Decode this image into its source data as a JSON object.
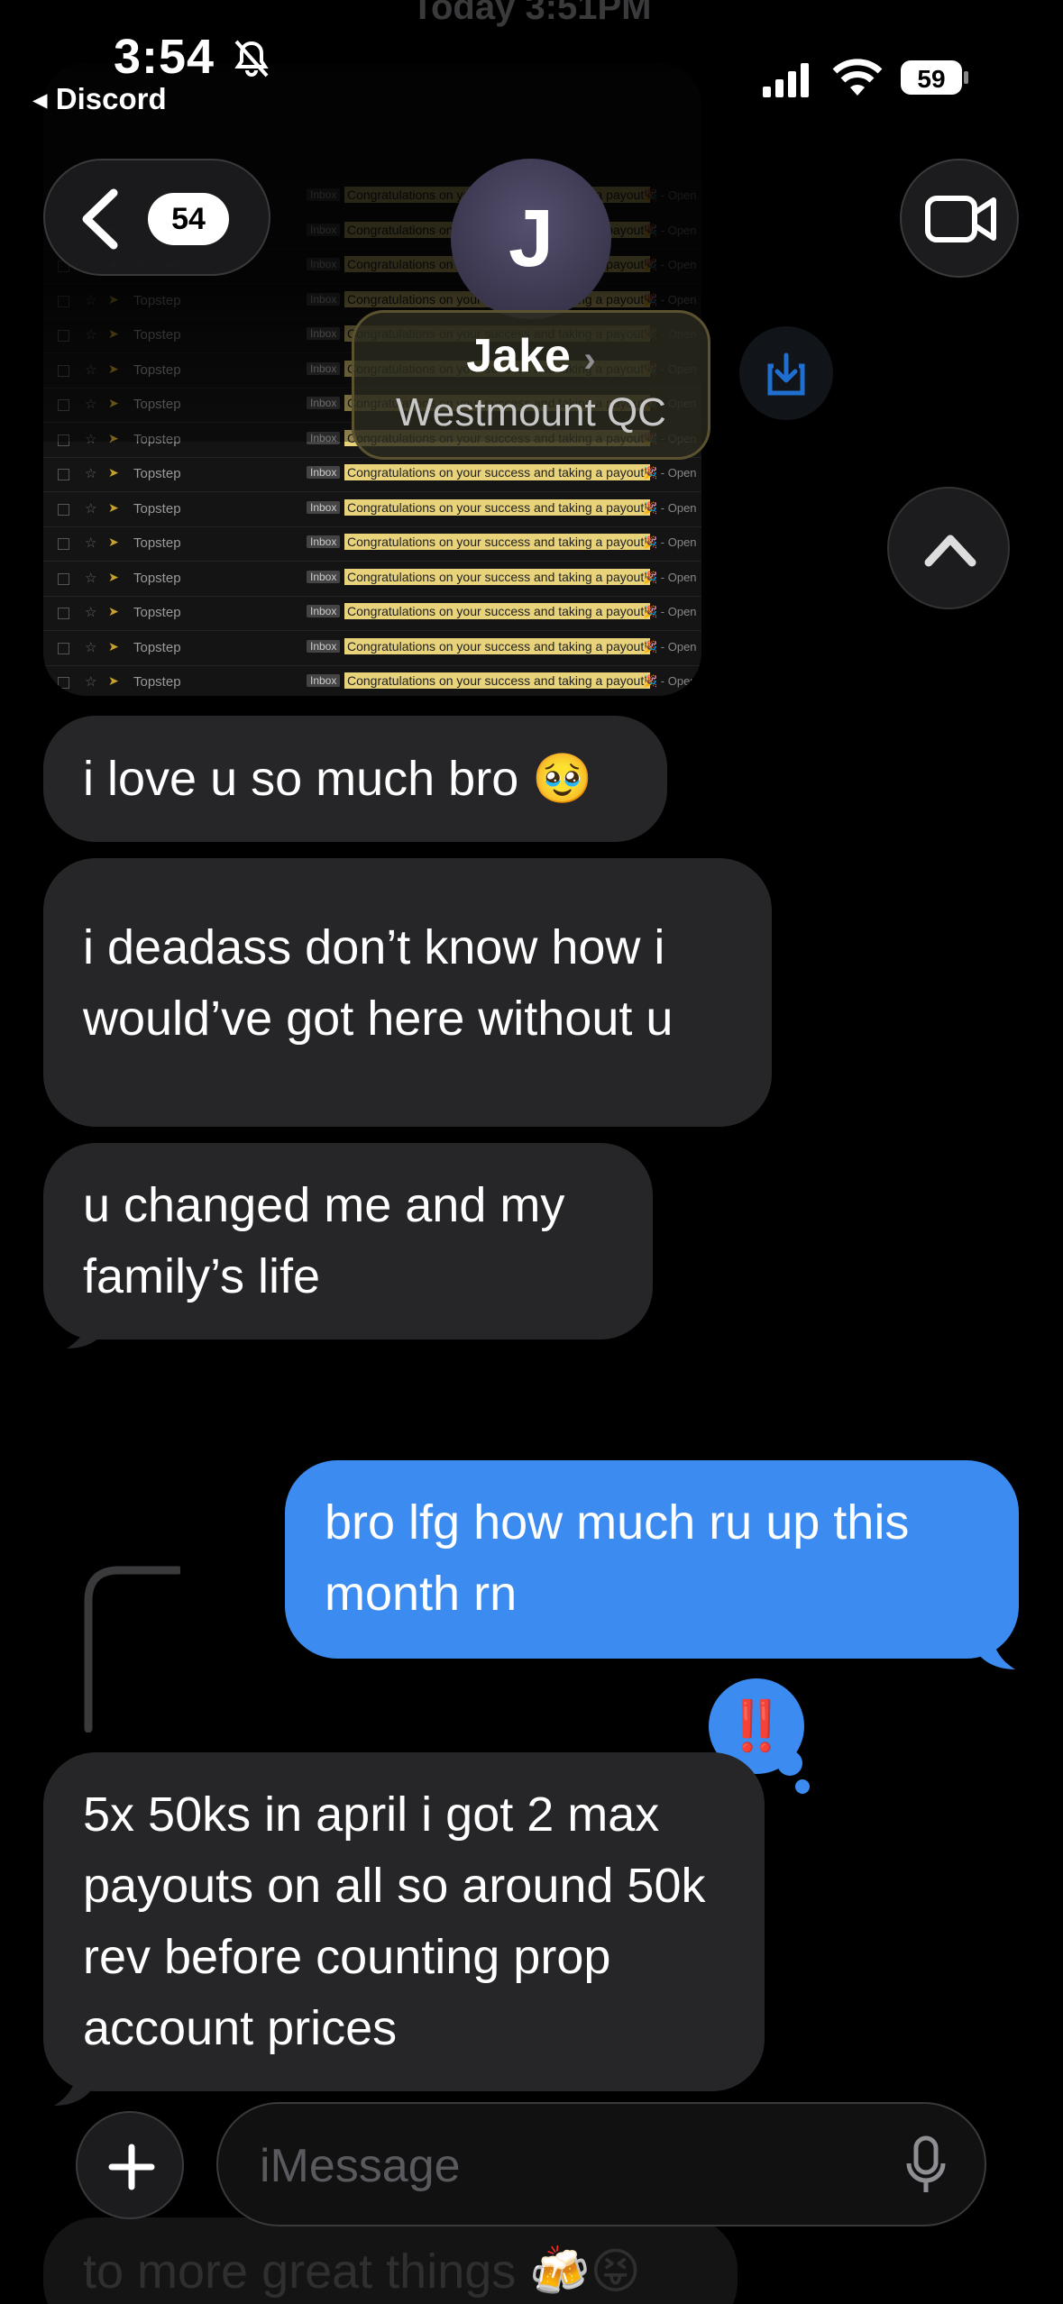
{
  "status_bar": {
    "time": "3:54",
    "back_app": "Discord",
    "battery": "59"
  },
  "header": {
    "back_count": "54",
    "contact_initial": "J",
    "contact_name": "Jake",
    "contact_location": "Westmount QC"
  },
  "timestamp": "Today 3:51PM",
  "email_screenshot": {
    "sender": "Topstep",
    "tag": "Inbox",
    "subject": "Congratulations on your success and taking a payout!",
    "tail": "🎉 - Open"
  },
  "messages": [
    {
      "dir": "received",
      "text": "i love u so much bro 🥹"
    },
    {
      "dir": "received",
      "text": "i deadass don’t know how i would’ve got here without u"
    },
    {
      "dir": "received",
      "text": "u changed me and my family’s life"
    },
    {
      "dir": "sent",
      "text": "bro lfg how much ru up this month rn"
    },
    {
      "dir": "received",
      "text": "5x 50ks in april i got 2 max payouts on all so around 50k rev before counting prop account prices"
    },
    {
      "dir": "received",
      "text": "to more great things 🍻😝"
    }
  ],
  "tapback": "‼️",
  "composer": {
    "placeholder": "iMessage"
  }
}
